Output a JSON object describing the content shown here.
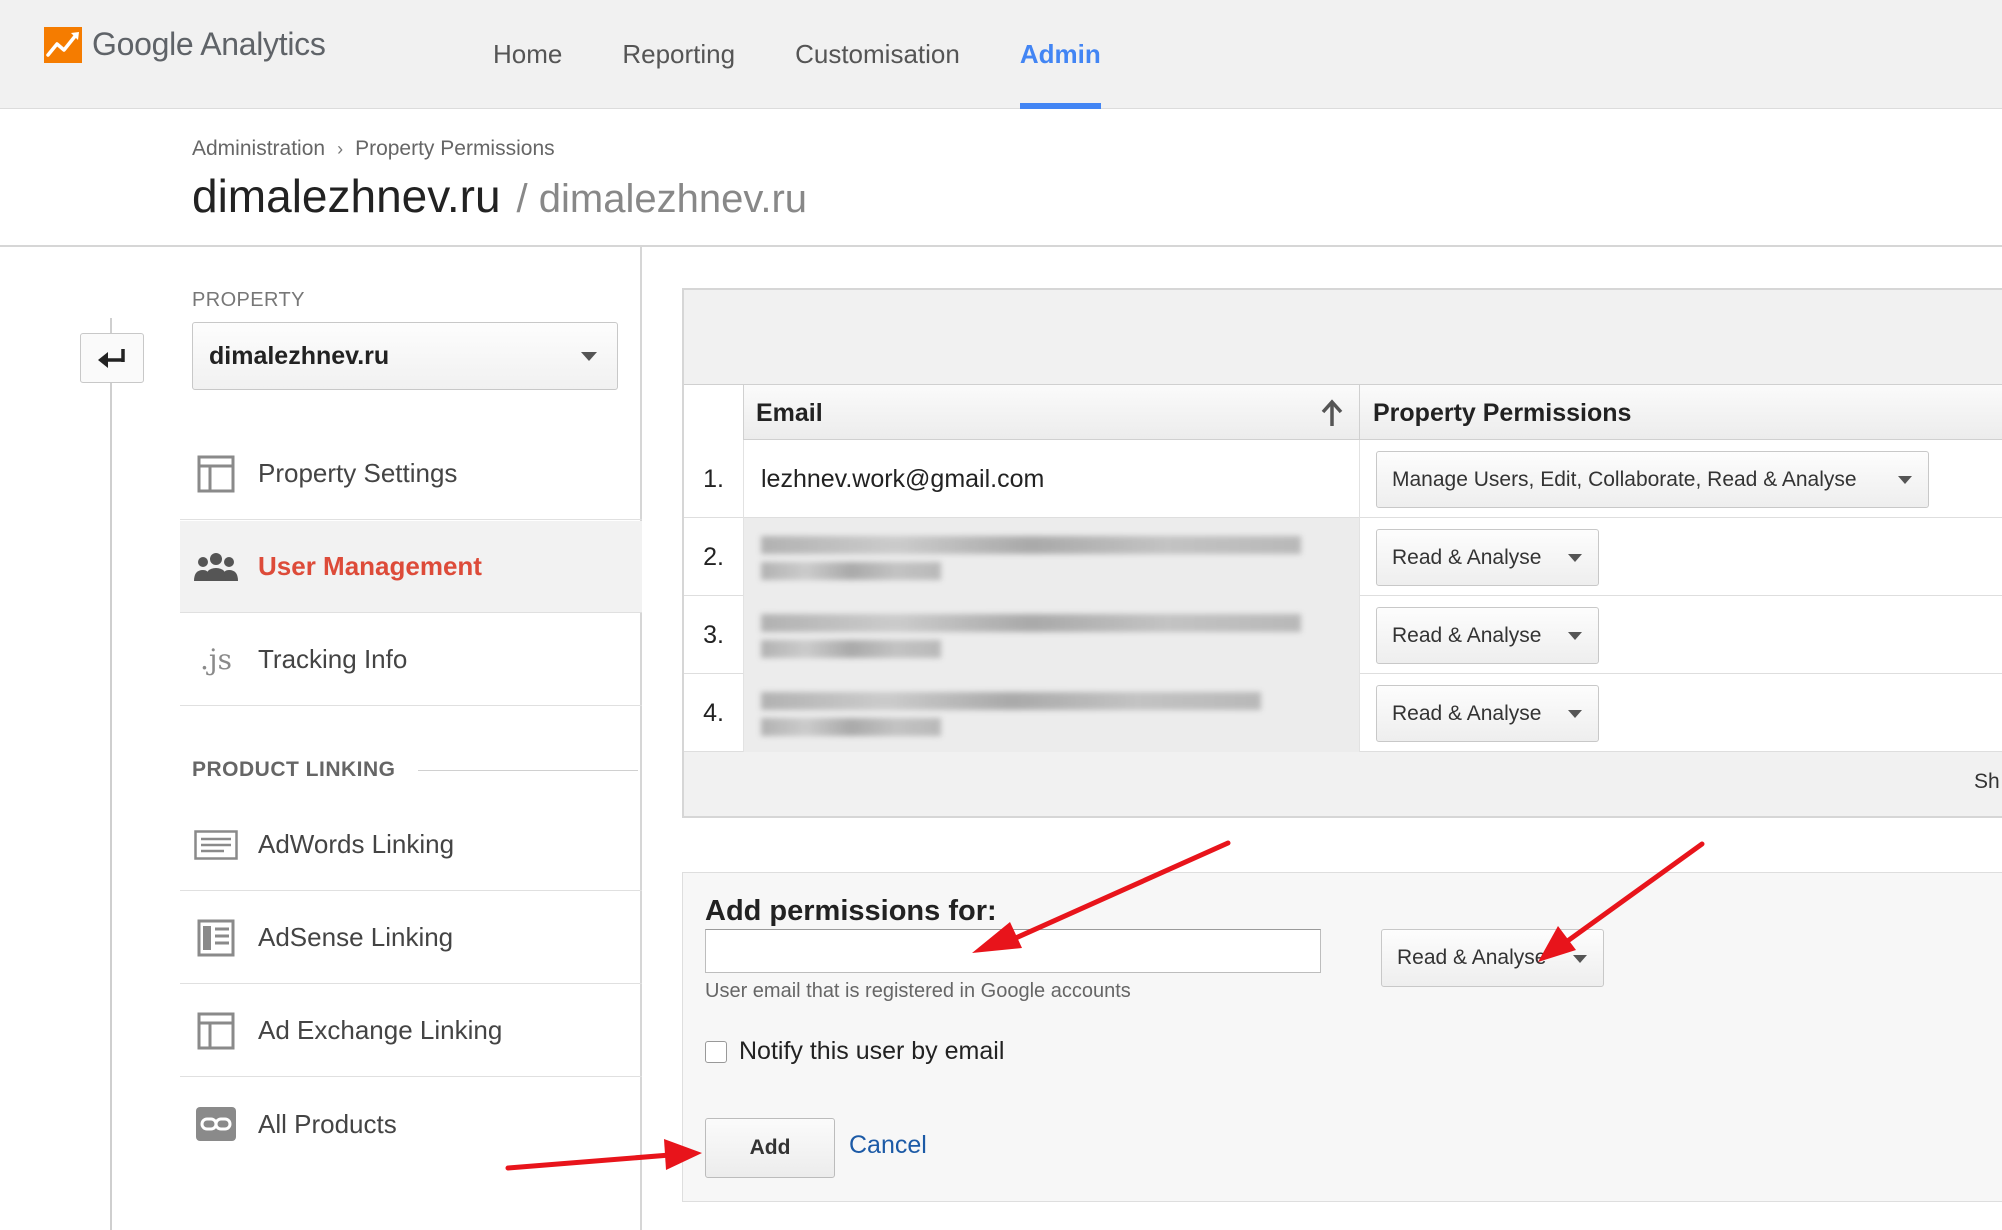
{
  "app": {
    "logo_text": "Google Analytics",
    "logo_icon": "analytics-logo-icon"
  },
  "nav": {
    "items": [
      {
        "label": "Home"
      },
      {
        "label": "Reporting"
      },
      {
        "label": "Customisation"
      },
      {
        "label": "Admin",
        "active": true
      }
    ],
    "active_color": "#4285f4"
  },
  "breadcrumb": {
    "items": [
      "Administration",
      "Property Permissions"
    ],
    "separator": "›"
  },
  "title": {
    "main": "dimalezhnev.ru",
    "sub": "/ dimalezhnev.ru"
  },
  "sidebar": {
    "property_label": "PROPERTY",
    "property_value": "dimalezhnev.ru",
    "items": [
      {
        "label": "Property Settings",
        "icon": "layout-icon"
      },
      {
        "label": "User Management",
        "icon": "users-icon",
        "active": true
      },
      {
        "label": "Tracking Info",
        "icon": "js-icon"
      }
    ],
    "product_linking_label": "PRODUCT LINKING",
    "linking_items": [
      {
        "label": "AdWords Linking",
        "icon": "adwords-icon"
      },
      {
        "label": "AdSense Linking",
        "icon": "adsense-icon"
      },
      {
        "label": "Ad Exchange Linking",
        "icon": "layout-icon"
      },
      {
        "label": "All Products",
        "icon": "link-icon"
      }
    ],
    "active_color": "#dd4b39"
  },
  "table": {
    "columns": [
      "Email",
      "Property Permissions"
    ],
    "rows": [
      {
        "num": "1.",
        "email": "lezhnev.work@gmail.com",
        "permission": "Manage Users, Edit, Collaborate, Read & Analyse",
        "blurred": false
      },
      {
        "num": "2.",
        "email": "",
        "permission": "Read & Analyse",
        "blurred": true
      },
      {
        "num": "3.",
        "email": "",
        "permission": "Read & Analyse",
        "blurred": true
      },
      {
        "num": "4.",
        "email": "",
        "permission": "Read & Analyse",
        "blurred": true
      }
    ],
    "footer_text": "Sh"
  },
  "add_permissions": {
    "title": "Add permissions for:",
    "email_value": "",
    "hint": "User email that is registered in Google accounts",
    "permission": "Read & Analyse",
    "notify_label": "Notify this user by email",
    "notify_checked": false,
    "add_label": "Add",
    "cancel_label": "Cancel"
  },
  "annotation_color": "#e8141b"
}
